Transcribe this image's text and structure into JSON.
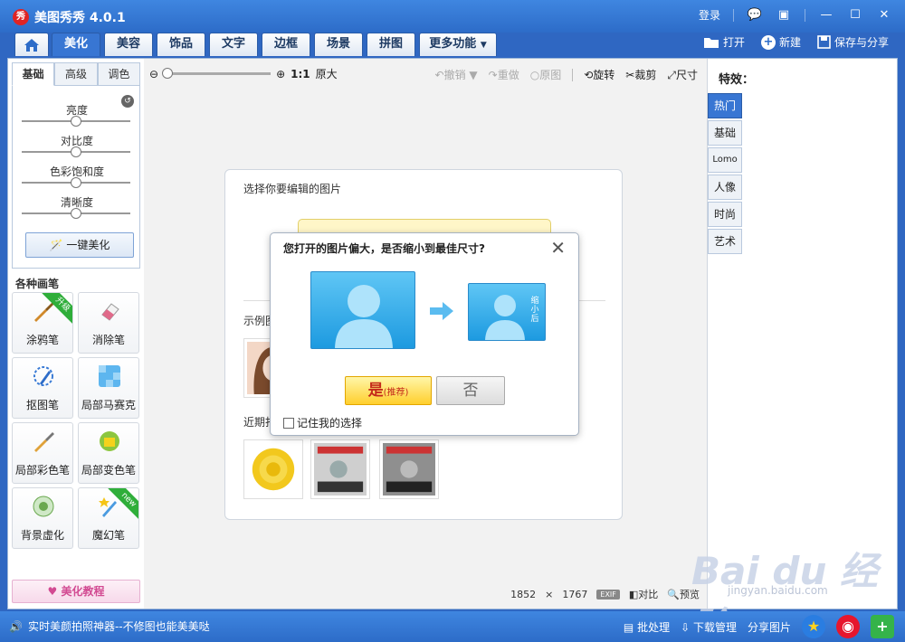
{
  "app": {
    "title": "美图秀秀 4.0.1",
    "logo_text": "秀"
  },
  "window": {
    "login": "登录",
    "minimize": "—",
    "maximize": "☐",
    "close": "✕"
  },
  "tabs": [
    "美化",
    "美容",
    "饰品",
    "文字",
    "边框",
    "场景",
    "拼图",
    "更多功能"
  ],
  "toolbar": {
    "open": "打开",
    "new": "新建",
    "save_share": "保存与分享"
  },
  "left": {
    "subtabs": [
      "基础",
      "高级",
      "调色"
    ],
    "sliders": [
      "亮度",
      "对比度",
      "色彩饱和度",
      "清晰度"
    ],
    "one_key": "一键美化",
    "brush_title": "各种画笔",
    "brushes": [
      "涂鸦笔",
      "消除笔",
      "抠图笔",
      "局部马赛克",
      "局部彩色笔",
      "局部变色笔",
      "背景虚化",
      "魔幻笔"
    ],
    "badge_upgrade": "升级",
    "badge_new": "new",
    "tutorial": "美化教程"
  },
  "canvas": {
    "zoom_ratio": "1:1",
    "zoom_original": "原大",
    "undo": "撤销",
    "redo": "重做",
    "original": "原图",
    "rotate": "旋转",
    "crop": "裁剪",
    "size": "尺寸",
    "open_title": "选择你要编辑的图片",
    "sample_label": "示例图",
    "recent_label": "近期打",
    "image_size_w": "1852",
    "image_size_x": "×",
    "image_size_h": "1767",
    "exif": "EXIF",
    "compare": "对比",
    "preview": "预览"
  },
  "dialog": {
    "title": "您打开的图片偏大，是否缩小到最佳尺寸?",
    "close": "✕",
    "small_label": "缩小后",
    "yes": "是",
    "yes_sub": "(推荐)",
    "no": "否",
    "remember": "记住我的选择"
  },
  "right": {
    "title": "特效：",
    "tabs": [
      "热门",
      "基础",
      "Lomo",
      "人像",
      "时尚",
      "艺术"
    ]
  },
  "watermark": {
    "brand": "Bai du 经验",
    "url": "jingyan.baidu.com"
  },
  "statusbar": {
    "left_text": "实时美颜拍照神器--不修图也能美美哒",
    "batch": "批处理",
    "download": "下载管理",
    "share": "分享图片"
  }
}
